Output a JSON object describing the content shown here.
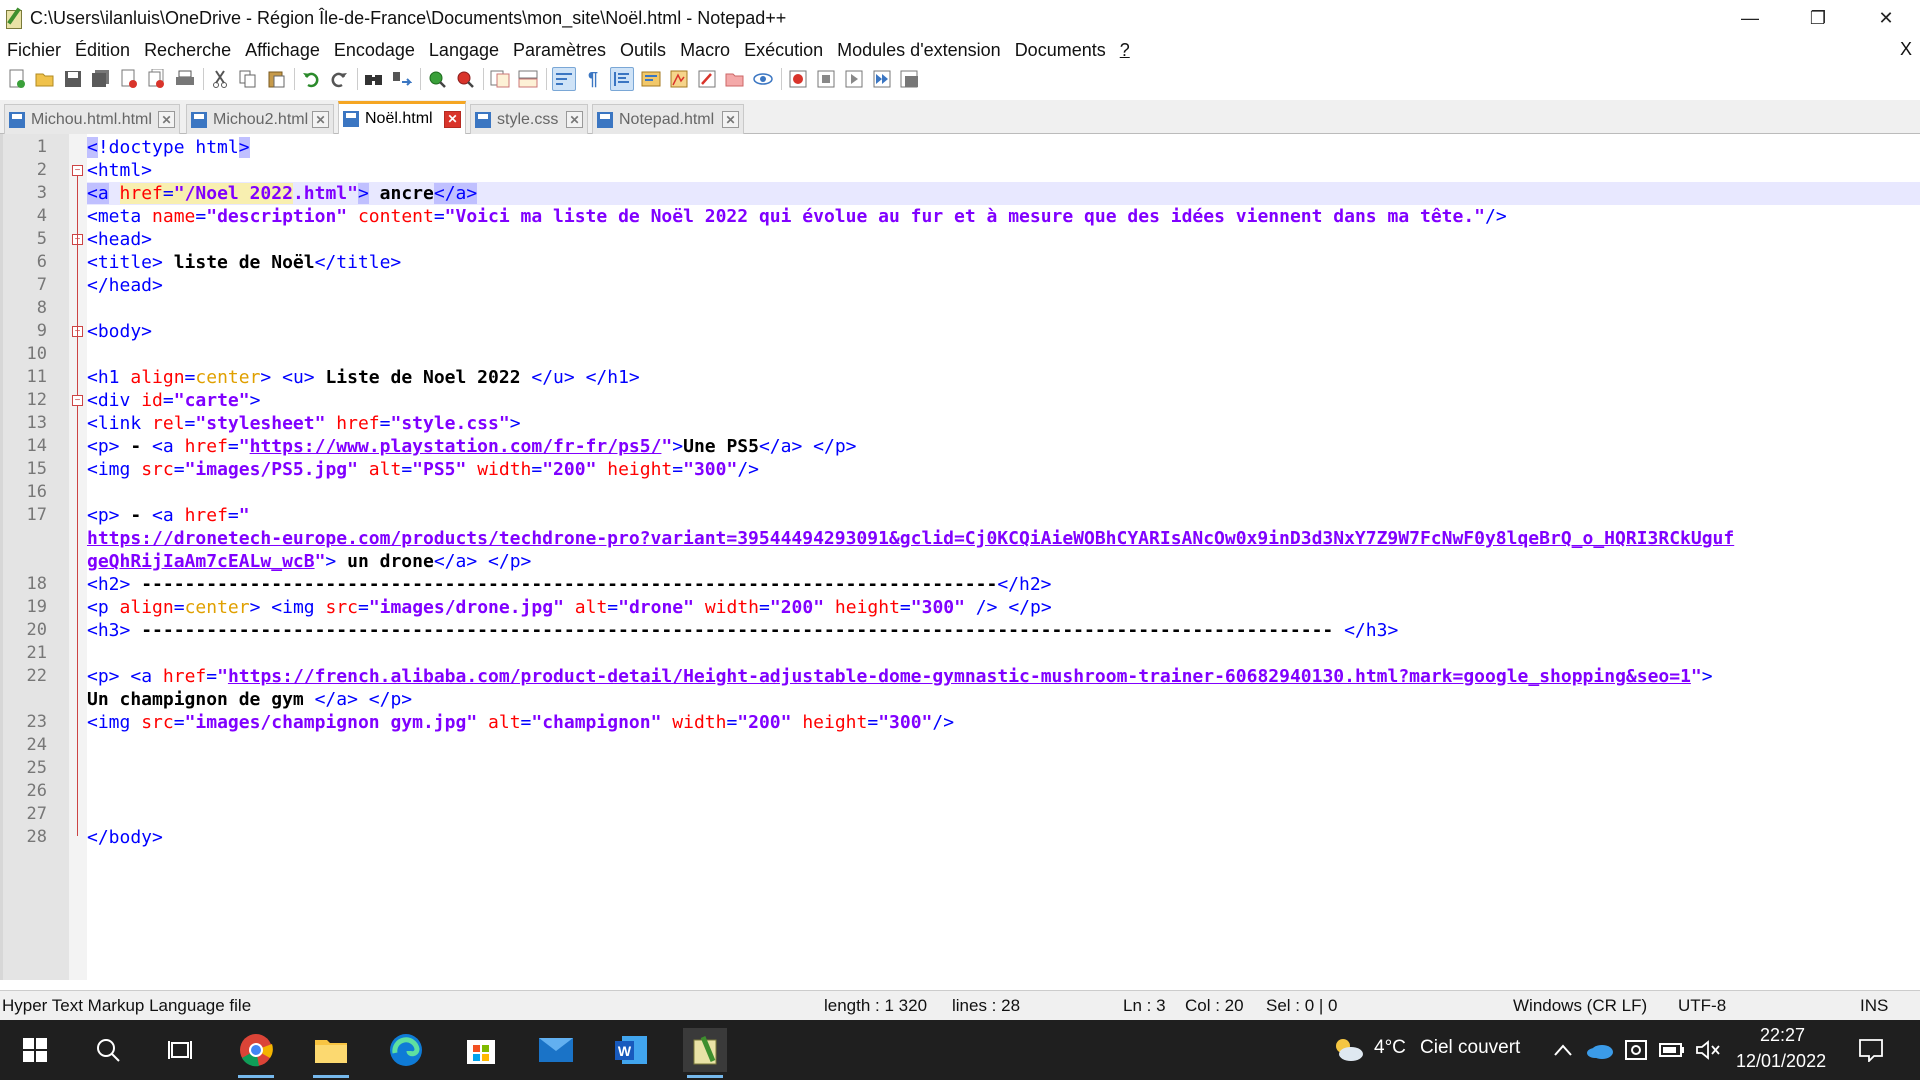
{
  "window": {
    "title": "C:\\Users\\ilanluis\\OneDrive - Région Île-de-France\\Documents\\mon_site\\Noël.html - Notepad++",
    "minimize": "—",
    "maximize": "❐",
    "close": "✕"
  },
  "menu": {
    "items": [
      "Fichier",
      "Édition",
      "Recherche",
      "Affichage",
      "Encodage",
      "Langage",
      "Paramètres",
      "Outils",
      "Macro",
      "Exécution",
      "Modules d'extension",
      "Documents",
      "?"
    ],
    "close": "X"
  },
  "tabs": [
    {
      "label": "Michou.html.html",
      "active": false
    },
    {
      "label": "Michou2.html",
      "active": false
    },
    {
      "label": "Noël.html",
      "active": true
    },
    {
      "label": "style.css",
      "active": false
    },
    {
      "label": "Notepad.html",
      "active": false
    }
  ],
  "editor": {
    "line_numbers": [
      "1",
      "2",
      "3",
      "4",
      "5",
      "6",
      "7",
      "8",
      "9",
      "10",
      "11",
      "12",
      "13",
      "14",
      "15",
      "16",
      "17",
      "",
      "",
      "18",
      "19",
      "20",
      "21",
      "22",
      "",
      "23",
      "24",
      "25",
      "26",
      "27",
      "28"
    ],
    "current_line": 3
  },
  "status": {
    "file_type": "Hyper Text Markup Language file",
    "length": "length : 1 320",
    "lines": "lines : 28",
    "ln": "Ln : 3",
    "col": "Col : 20",
    "sel": "Sel : 0 | 0",
    "eol": "Windows (CR LF)",
    "encoding": "UTF-8",
    "mode": "INS"
  },
  "taskbar": {
    "weather_temp": "4°C",
    "weather_desc": "Ciel couvert",
    "time": "22:27",
    "date": "12/01/2022"
  },
  "colors": {
    "tag": "#0000ff",
    "attribute": "#ff0000",
    "value": "#8000ff",
    "active_tab_accent": "#f5a623",
    "taskbar": "#1f1f1f"
  }
}
